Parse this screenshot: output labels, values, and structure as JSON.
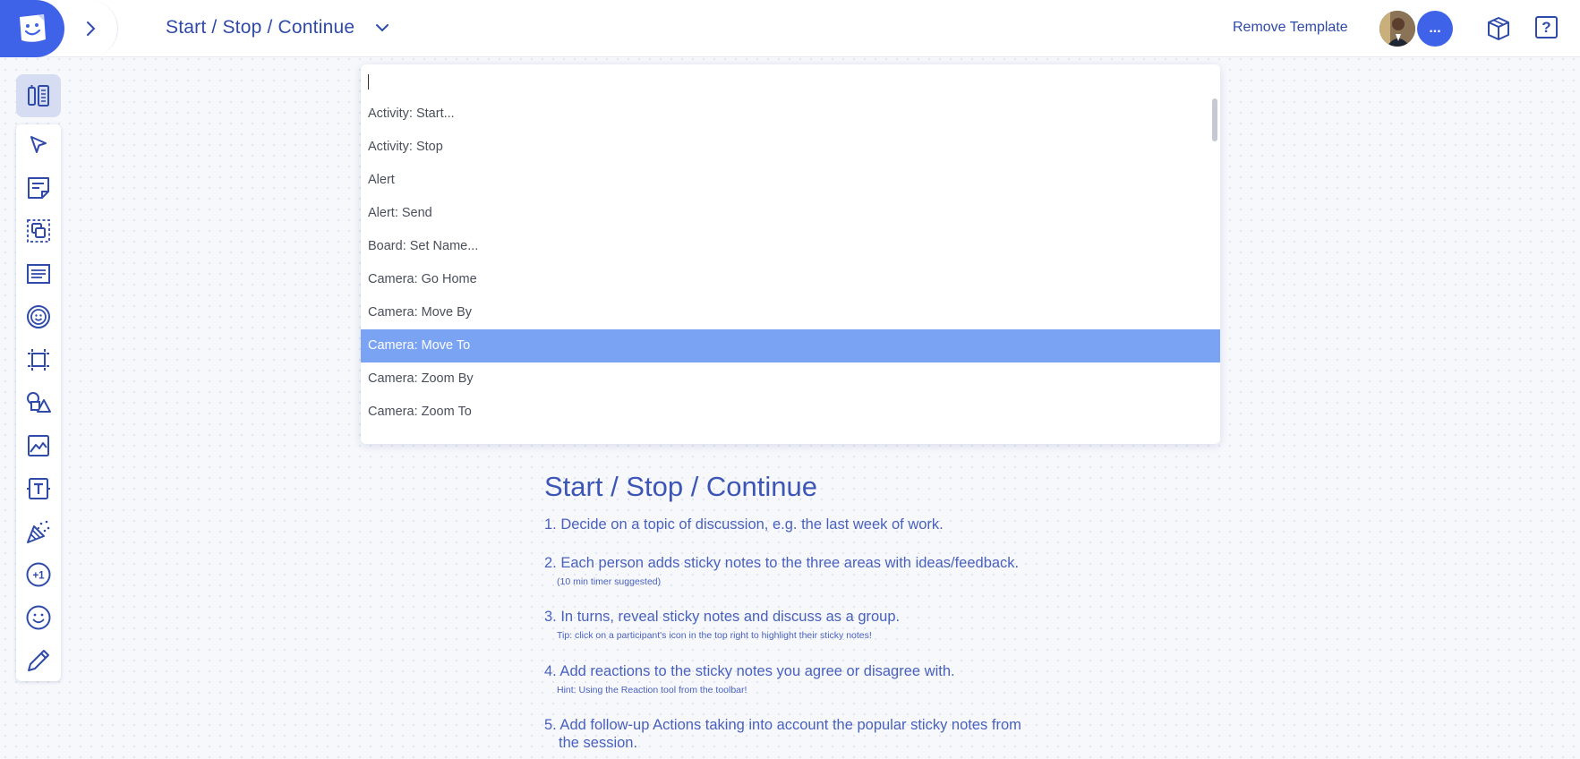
{
  "header": {
    "board_title": "Start / Stop / Continue",
    "remove_template_label": "Remove Template",
    "more_users_label": "...",
    "help_label": "?",
    "accent_color": "#3f63e8"
  },
  "toolbar": {
    "tools": [
      "select-arrow-icon",
      "sticky-note-icon",
      "multi-select-icon",
      "text-block-icon",
      "reaction-icon",
      "frame-icon",
      "shapes-icon",
      "image-icon",
      "text-tool-icon",
      "celebrate-icon",
      "plus-one-icon",
      "emoji-icon",
      "pencil-icon"
    ]
  },
  "command_palette": {
    "input_value": "",
    "items": [
      "Activity: Start...",
      "Activity: Stop",
      "Alert",
      "Alert: Send",
      "Board: Set Name...",
      "Camera: Go Home",
      "Camera: Move By",
      "Camera: Move To",
      "Camera: Zoom By",
      "Camera: Zoom To"
    ],
    "selected_item": "Camera: Move To",
    "highlight_color": "#7aa3f4"
  },
  "board": {
    "heading": "Start / Stop / Continue",
    "steps": [
      {
        "text": "1. Decide on a topic of discussion, e.g. the last week of work.",
        "hint": ""
      },
      {
        "text": "2. Each person adds sticky notes to the three areas with ideas/feedback.",
        "hint": "(10 min timer suggested)"
      },
      {
        "text": "3. In turns, reveal sticky notes and discuss as a group.",
        "hint": "Tip: click on a participant's icon in the top right to highlight their sticky notes!"
      },
      {
        "text": "4. Add reactions to the sticky notes you agree or disagree with.",
        "hint": "Hint: Using the Reaction tool from the toolbar!"
      },
      {
        "text": "5. Add follow-up Actions taking into account the popular sticky notes from",
        "hint": ""
      }
    ],
    "step5_continuation": "the session."
  }
}
